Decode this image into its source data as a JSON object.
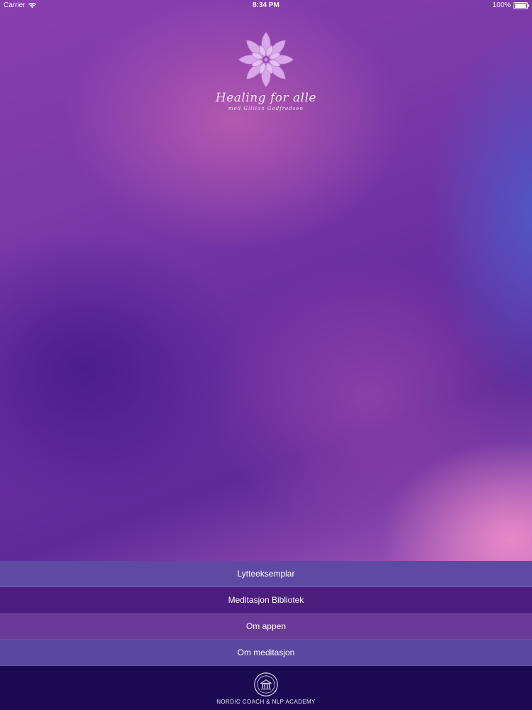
{
  "status_bar": {
    "carrier": "Carrier",
    "time": "8:34 PM",
    "battery": "100%",
    "battery_level": 1.0
  },
  "branding": {
    "title": "Healing for alle",
    "subtitle": "med Gillian Godfredsen",
    "logo_icon": "lotus-flower-icon"
  },
  "menu": {
    "items": [
      {
        "label": "Lytteeksemplar",
        "color": "#5e4aa2"
      },
      {
        "label": "Meditasjon Bibliotek",
        "color": "#4c1c7e"
      },
      {
        "label": "Om appen",
        "color": "#6b3a98"
      },
      {
        "label": "Om meditasjon",
        "color": "#5a47a0"
      }
    ]
  },
  "footer": {
    "text": "NORDIC COACH & NLP ACADEMY",
    "seal_icon": "academy-seal-icon"
  },
  "colors": {
    "footer_bg": "#1b0a52",
    "logo": "#d9a6ea"
  }
}
